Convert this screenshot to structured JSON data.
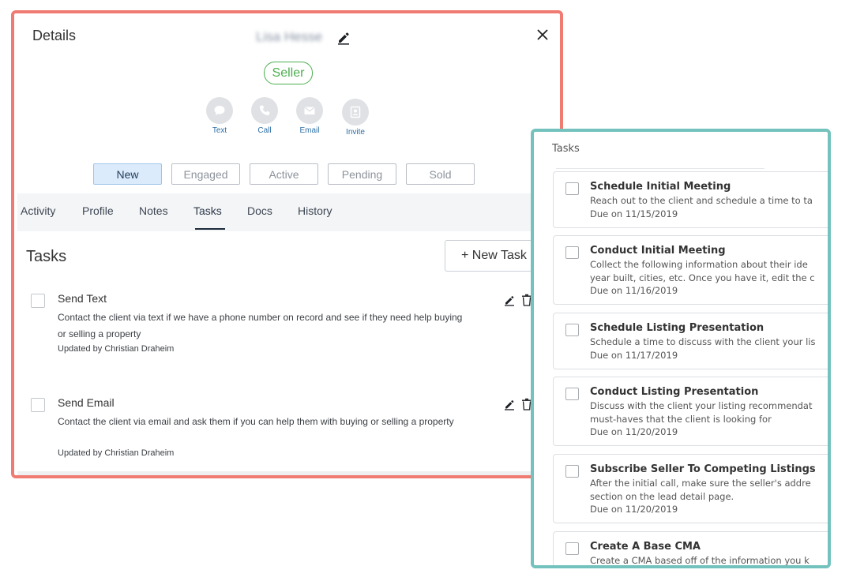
{
  "details": {
    "title": "Details",
    "lead_name": "Lisa Hesse",
    "badge": "Seller",
    "contact_actions": [
      {
        "label": "Text",
        "icon": "chat-icon"
      },
      {
        "label": "Call",
        "icon": "phone-icon"
      },
      {
        "label": "Email",
        "icon": "envelope-icon"
      },
      {
        "label": "Invite",
        "icon": "contact-card-icon"
      }
    ],
    "stages": [
      "New",
      "Engaged",
      "Active",
      "Pending",
      "Sold"
    ],
    "selected_stage": "New",
    "tabs": [
      "Activity",
      "Profile",
      "Notes",
      "Tasks",
      "Docs",
      "History"
    ],
    "selected_tab": "Tasks",
    "tasks_heading": "Tasks",
    "new_task_label": "+ New Task",
    "tasks": [
      {
        "title": "Send Text",
        "description": "Contact the client via text if we have a phone number on record and see if they need help buying or selling a property",
        "meta": "Updated by Christian Draheim"
      },
      {
        "title": "Send Email",
        "description": "Contact the client via email and ask them if you can help them with buying or selling a property",
        "meta": "Updated by Christian Draheim"
      }
    ]
  },
  "task_templates": {
    "header": "Tasks",
    "items": [
      {
        "title": "Schedule Initial Meeting",
        "lines": [
          "Reach out to the client and schedule a time to ta"
        ],
        "due": "Due on 11/15/2019"
      },
      {
        "title": "Conduct Initial Meeting",
        "lines": [
          "Collect the following information about their ide",
          "year built, cities, etc. Once you have it, edit the c"
        ],
        "due": "Due on 11/16/2019"
      },
      {
        "title": "Schedule Listing Presentation",
        "lines": [
          "Schedule a time to discuss with the client your lis"
        ],
        "due": "Due on 11/17/2019"
      },
      {
        "title": "Conduct Listing Presentation",
        "lines": [
          "Discuss with the client your listing recommendat",
          "must-haves that the client is looking for"
        ],
        "due": "Due on 11/20/2019"
      },
      {
        "title": "Subscribe Seller To Competing Listings",
        "lines": [
          "After the initial call, make sure the seller's addre",
          "section on the lead detail page."
        ],
        "due": "Due on 11/20/2019"
      },
      {
        "title": "Create A Base CMA",
        "lines": [
          "Create a CMA based off of the information you k"
        ],
        "due": ""
      }
    ]
  },
  "colors": {
    "details_frame": "#ef7b72",
    "tasks_frame": "#74c2bd",
    "seller_green": "#4caf50",
    "stage_selected_bg": "#dcebfb",
    "link_blue": "#2c6fa6"
  }
}
